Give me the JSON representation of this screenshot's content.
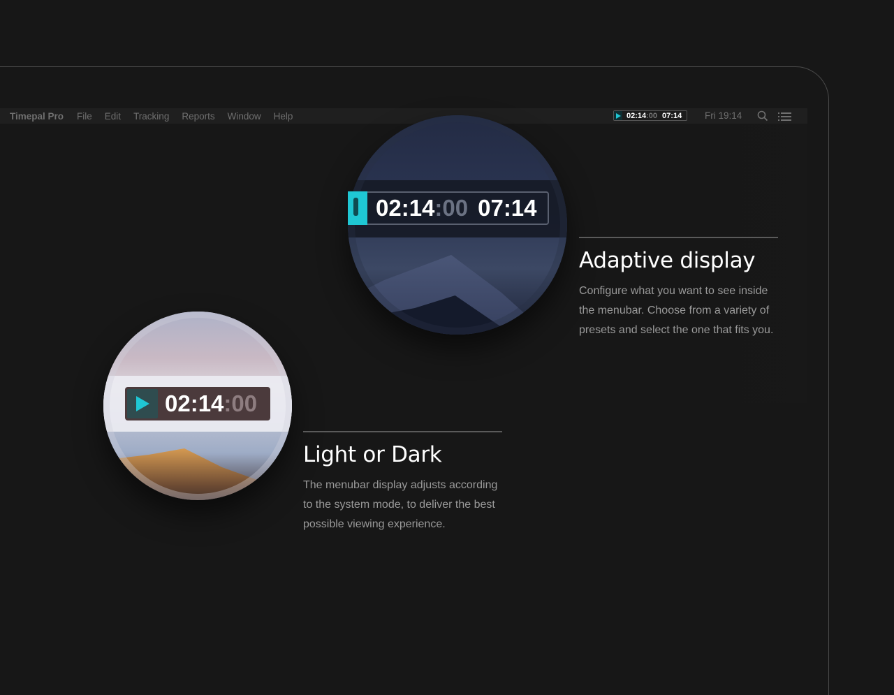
{
  "menubar": {
    "app_name": "Timepal Pro",
    "items": [
      "File",
      "Edit",
      "Tracking",
      "Reports",
      "Window",
      "Help"
    ],
    "timer": {
      "elapsed_main": "02:14",
      "elapsed_sec": ":00",
      "total": "07:14"
    },
    "clock": "Fri 19:14"
  },
  "dark_preview": {
    "elapsed_main": "02:14",
    "elapsed_sec": ":00",
    "total": "07:14",
    "accent": "#1fc7d4"
  },
  "light_preview": {
    "elapsed_main": "02:14",
    "elapsed_sec": ":00",
    "accent": "#1fc7d4"
  },
  "features": [
    {
      "title": "Adaptive display",
      "body": "Configure what you want to see inside the menubar. Choose from a variety of presets and select the one that fits you."
    },
    {
      "title": "Light or Dark",
      "body": "The menubar display adjusts according to the system mode, to deliver the best possible viewing experience."
    }
  ]
}
